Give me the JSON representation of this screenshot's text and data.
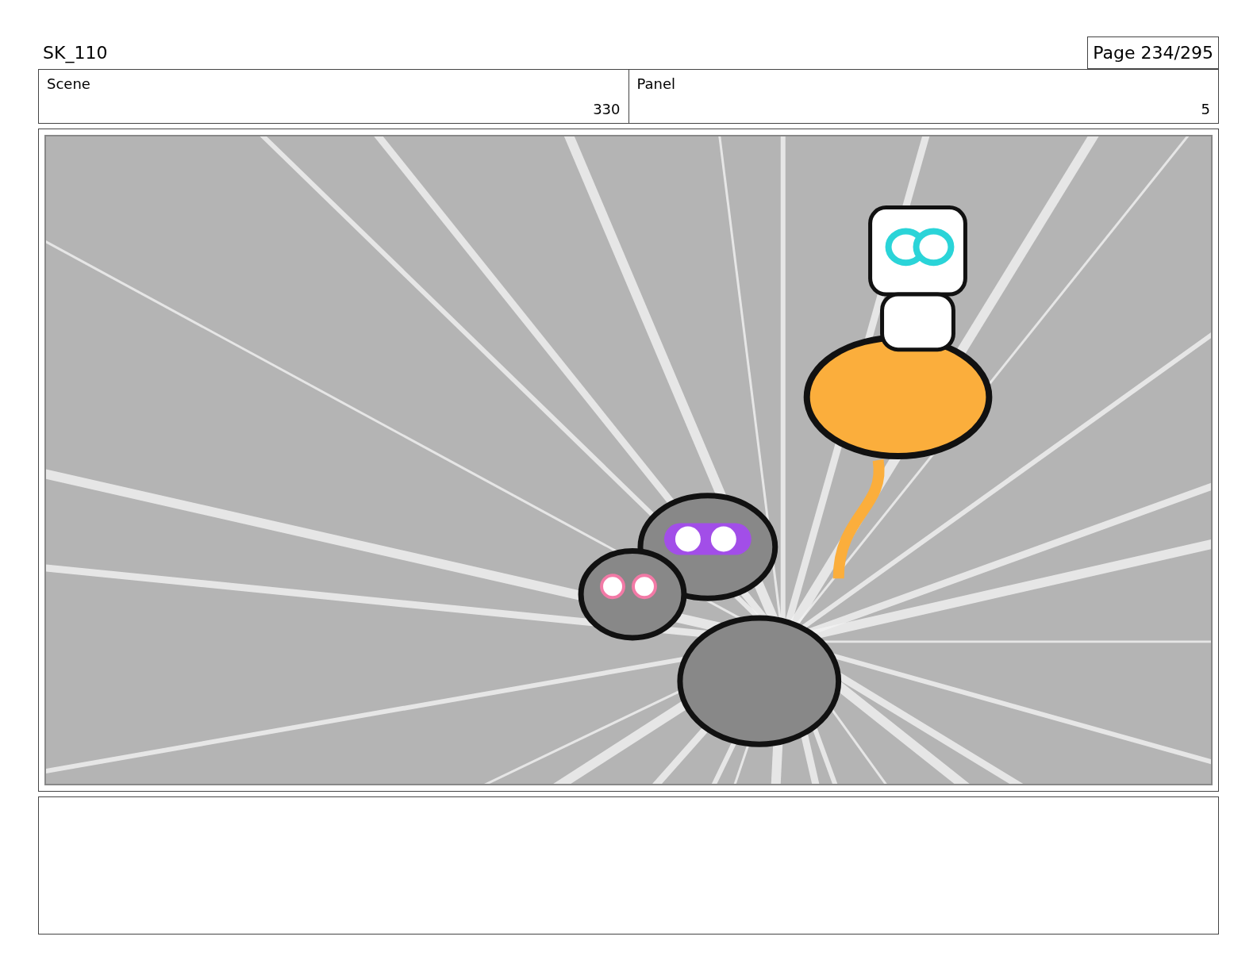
{
  "header": {
    "title": "SK_110",
    "page": "Page 234/295"
  },
  "info": [
    {
      "label": "Scene",
      "value": "330"
    },
    {
      "label": "Panel",
      "value": "5"
    }
  ]
}
